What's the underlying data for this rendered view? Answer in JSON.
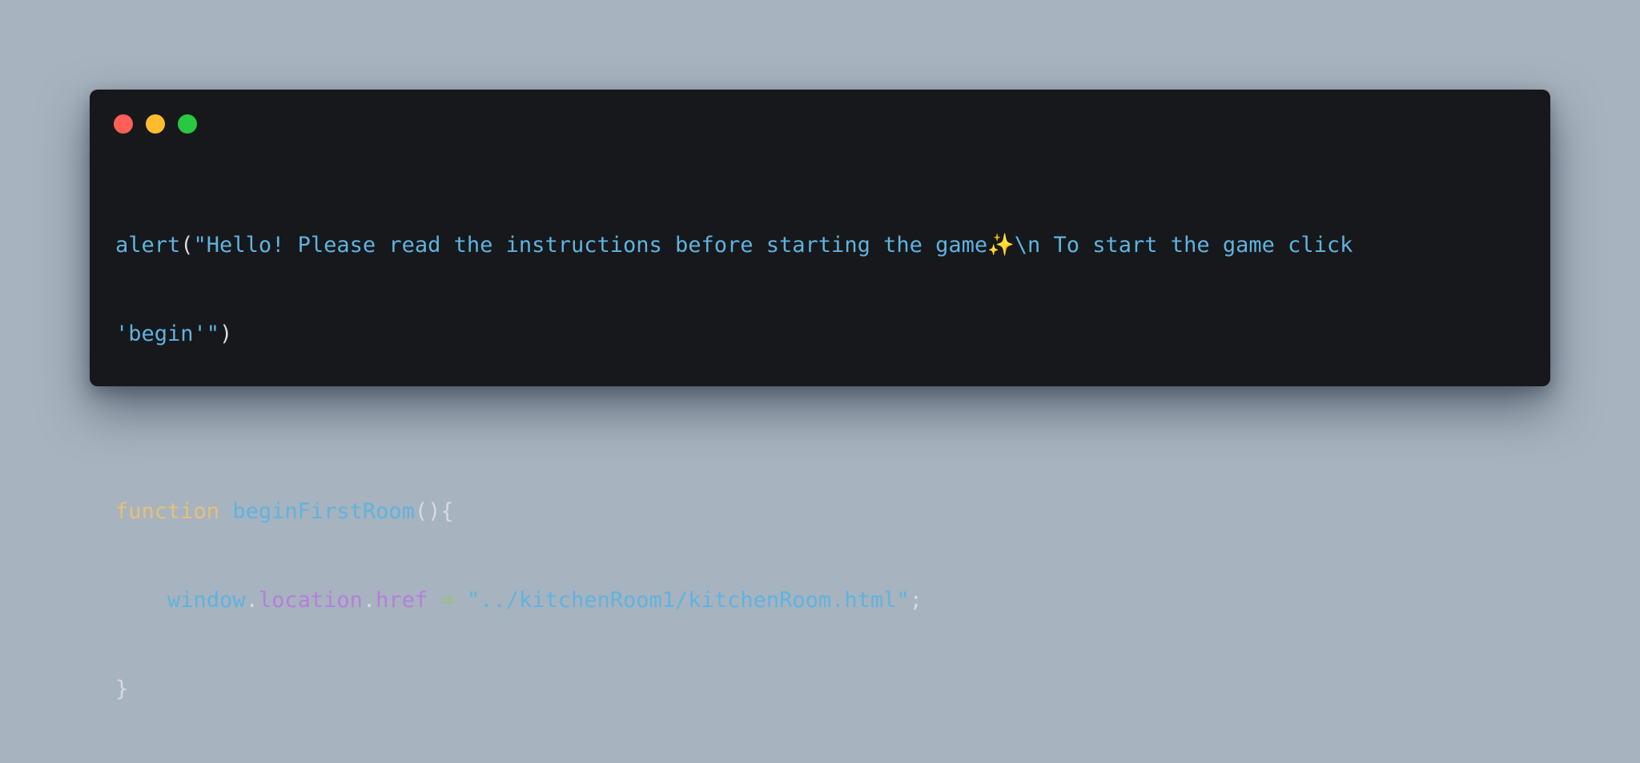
{
  "window": {
    "controls": [
      {
        "name": "close",
        "color": "#ff5f57"
      },
      {
        "name": "minimize",
        "color": "#febc2e"
      },
      {
        "name": "maximize",
        "color": "#28c840"
      }
    ]
  },
  "colors": {
    "background": "#a7b3bf",
    "editor": "#16181b",
    "default": "#d7dae0",
    "identifier": "#5fb3e0",
    "keyword": "#e5c07b",
    "property": "#b57edc",
    "operator": "#98c379"
  },
  "code": {
    "lines": [
      [
        {
          "text": "alert",
          "kind": "identifier"
        },
        {
          "text": "(",
          "kind": "default"
        },
        {
          "text": "\"Hello! Please read the instructions before starting the game✨\\n To start the game click",
          "kind": "identifier"
        }
      ],
      [
        {
          "text": "'begin'\"",
          "kind": "identifier"
        },
        {
          "text": ")",
          "kind": "default"
        }
      ],
      [],
      [
        {
          "text": "function",
          "kind": "keyword"
        },
        {
          "text": " ",
          "kind": "default"
        },
        {
          "text": "beginFirstRoom",
          "kind": "identifier"
        },
        {
          "text": "(){",
          "kind": "default"
        }
      ],
      [
        {
          "text": "window",
          "kind": "identifier",
          "indent": true
        },
        {
          "text": ".",
          "kind": "default"
        },
        {
          "text": "location",
          "kind": "property"
        },
        {
          "text": ".",
          "kind": "default"
        },
        {
          "text": "href",
          "kind": "property"
        },
        {
          "text": " ",
          "kind": "default"
        },
        {
          "text": "=",
          "kind": "operator"
        },
        {
          "text": " ",
          "kind": "default"
        },
        {
          "text": "\"../kitchenRoom1/kitchenRoom.html\"",
          "kind": "identifier"
        },
        {
          "text": ";",
          "kind": "default"
        }
      ],
      [
        {
          "text": "}",
          "kind": "default"
        }
      ]
    ]
  }
}
